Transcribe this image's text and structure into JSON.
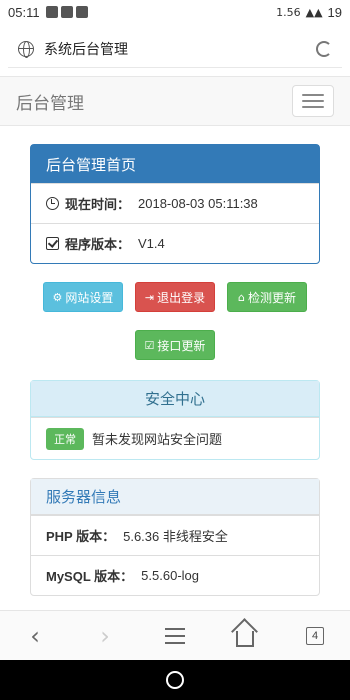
{
  "status": {
    "time": "05:11",
    "speed": "1.56",
    "battery": "19"
  },
  "browser": {
    "page_title": "系统后台管理",
    "tab_count": "4"
  },
  "navbar": {
    "brand": "后台管理"
  },
  "info_panel": {
    "title": "后台管理首页",
    "rows": [
      {
        "label": "现在时间：",
        "value": "2018-08-03 05:11:38"
      },
      {
        "label": "程序版本：",
        "value": "V1.4"
      }
    ]
  },
  "buttons": {
    "site_settings": "网站设置",
    "logout": "退出登录",
    "check_update": "检测更新",
    "api_update": "接口更新"
  },
  "security": {
    "title": "安全中心",
    "badge": "正常",
    "message": "暂未发现网站安全问题"
  },
  "server": {
    "title": "服务器信息",
    "rows": [
      {
        "label": "PHP 版本：",
        "value": "5.6.36 非线程安全"
      },
      {
        "label": "MySQL 版本：",
        "value": "5.5.60-log"
      }
    ]
  }
}
